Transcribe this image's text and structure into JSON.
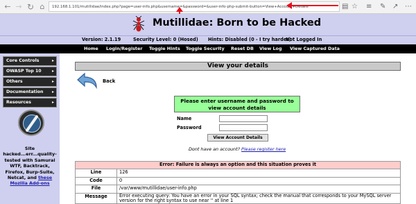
{
  "browser": {
    "url": "192.168.1.101/mutillidae/index.php?page=user-info.php&username=&password=&user-info-php-submit-button=View+Account+Details",
    "icons": [
      "back-icon",
      "forward-icon",
      "reload-icon",
      "home-icon",
      "reading-view-icon",
      "favorite-star-icon",
      "hub-icon",
      "web-note-icon",
      "share-icon",
      "more-icon"
    ]
  },
  "header": {
    "title": "Mutillidae: Born to be Hacked",
    "logo_icon": "ant-logo-icon",
    "background_color": "#cfcfef"
  },
  "status": {
    "version": "Version: 2.1.19",
    "security_level": "Security Level: 0 (Hosed)",
    "hints": "Hints: Disabled (0 - I try harder)",
    "login": "Not Logged In"
  },
  "topmenu": {
    "items": [
      "Home",
      "Login/Register",
      "Toggle Hints",
      "Toggle Security",
      "Reset DB",
      "View Log",
      "View Captured Data"
    ]
  },
  "sidebar": {
    "items": [
      "Core Controls",
      "OWASP Top 10",
      "Others",
      "Documentation",
      "Resources"
    ],
    "promo_text_1": "Site hacked...err...quality-tested with Samurai WTF, Backtrack, Firefox, Burp-Suite, Netcat, and",
    "promo_link": "these Mozilla Add-ons"
  },
  "main": {
    "heading": "View your details",
    "back_label": "Back",
    "login_box_text": "Please enter username and password to view account details",
    "name_label": "Name",
    "password_label": "Password",
    "name_value": "",
    "password_value": "",
    "submit_label": "View Account Details",
    "no_account_text": "Dont have an account?",
    "register_link": "Please register here"
  },
  "error": {
    "title": "Error: Failure is always an option and this situation proves it",
    "rows": [
      {
        "key": "Line",
        "value": "126"
      },
      {
        "key": "Code",
        "value": "0"
      },
      {
        "key": "File",
        "value": "/var/www/mutillidae/user-info.php"
      },
      {
        "key": "Message",
        "value": "Error executing query: You have an error in your SQL syntax; check the manual that corresponds to your MySQL server version for the right syntax to use near '' at line 1"
      }
    ],
    "header_color": "#ffcccc"
  }
}
